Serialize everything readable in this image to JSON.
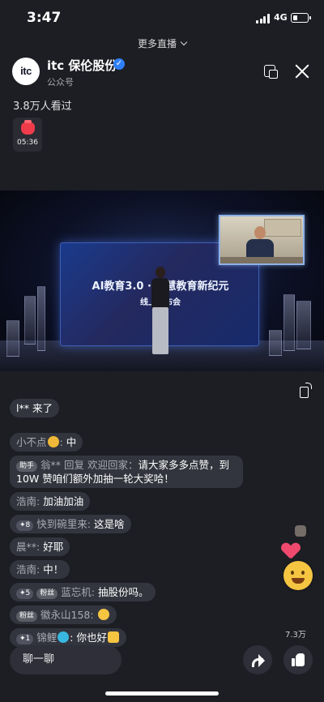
{
  "status_bar": {
    "time": "3:47",
    "network": "4G",
    "battery_level": 0.35
  },
  "header": {
    "more_live": "更多直播",
    "account_name": "itc 保伦股份",
    "account_type": "公众号",
    "avatar_text": "itc",
    "verified_icon": "verified-check-icon",
    "icons": [
      "float-window-icon",
      "close-icon"
    ]
  },
  "stats": {
    "viewers": "3.8万人看过"
  },
  "red_packet": {
    "icon": "red-packet-icon",
    "timer": "05:36"
  },
  "video": {
    "screen_title": "AI教育3.0 · 智慧教育新纪元",
    "screen_subtitle": "线上发布会"
  },
  "comments": [
    {
      "nick": "",
      "text": "l** 来了",
      "badges": []
    },
    {
      "nick": "小不点",
      "emoji": "bowl-emoji-icon",
      "text": "中",
      "badges": []
    },
    {
      "nick": "翁** 回复 欢迎回家：",
      "text": "请大家多多点赞，到 10W 赞咱们额外加抽一轮大奖哈！",
      "badges": [
        "助手"
      ]
    },
    {
      "nick": "浩南:",
      "text": "加油加油",
      "badges": []
    },
    {
      "nick": "快到碗里来:",
      "text": "这是啥",
      "badges": [
        "✦8"
      ]
    },
    {
      "nick": "晨**:",
      "text": "好耶",
      "badges": []
    },
    {
      "nick": "浩南:",
      "text": "中！",
      "badges": []
    },
    {
      "nick": "蓝忘机:",
      "text": "抽股份吗。",
      "badges": [
        "✦5",
        "粉丝"
      ]
    },
    {
      "nick": "徽永山158:",
      "emoji": "grin-emoji-icon",
      "text": "",
      "badges": [
        "粉丝"
      ]
    },
    {
      "nick": "锦鲤",
      "emoji": "fish-emoji-icon",
      "text": ": 你也好",
      "emoji_after": "thumbs-up-emoji-icon",
      "badges": [
        "✦1"
      ]
    }
  ],
  "likes": {
    "count": "7.3万"
  },
  "bottom_bar": {
    "chat_placeholder": "聊一聊",
    "share_icon": "share-icon",
    "like_icon": "thumbs-up-icon"
  },
  "colors": {
    "background": "#1d1e24",
    "verified_blue": "#2f7ff6",
    "red_packet": "#ef3b4a",
    "heart": "#ef4a6e"
  }
}
